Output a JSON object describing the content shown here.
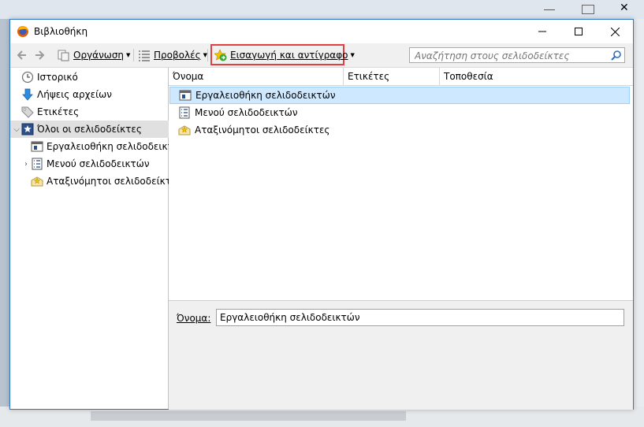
{
  "window": {
    "title": "Βιβλιοθήκη"
  },
  "toolbar": {
    "organize_label": "Οργάνωση",
    "views_label": "Προβολές",
    "import_label": "Εισαγωγή και αντίγραφο",
    "search_placeholder": "Αναζήτηση στους σελιδοδείκτες"
  },
  "sidebar": {
    "items": [
      {
        "label": "Ιστορικό",
        "icon": "clock-icon"
      },
      {
        "label": "Λήψεις αρχείων",
        "icon": "download-arrow-icon"
      },
      {
        "label": "Ετικέτες",
        "icon": "tag-icon"
      },
      {
        "label": "Όλοι οι σελιδοδείκτες",
        "icon": "star-bookmarks-icon",
        "expanded": true,
        "selected": true
      },
      {
        "label": "Εργαλειοθήκη σελιδοδεικτ...",
        "icon": "toolbar-folder-icon"
      },
      {
        "label": "Μενού σελιδοδεικτών",
        "icon": "menu-folder-icon",
        "collapsed": true
      },
      {
        "label": "Αταξινόμητοι σελιδοδείκτες",
        "icon": "unsorted-folder-icon"
      }
    ]
  },
  "columns": [
    "Όνομα",
    "Ετικέτες",
    "Τοποθεσία"
  ],
  "rows": [
    {
      "name": "Εργαλειοθήκη σελιδοδεικτών",
      "icon": "toolbar-folder-icon",
      "selected": true
    },
    {
      "name": "Μενού σελιδοδεικτών",
      "icon": "menu-folder-icon"
    },
    {
      "name": "Αταξινόμητοι σελιδοδείκτες",
      "icon": "unsorted-folder-icon"
    }
  ],
  "details": {
    "name_label": "Όνομα:",
    "name_value": "Εργαλειοθήκη σελιδοδεικτών"
  }
}
